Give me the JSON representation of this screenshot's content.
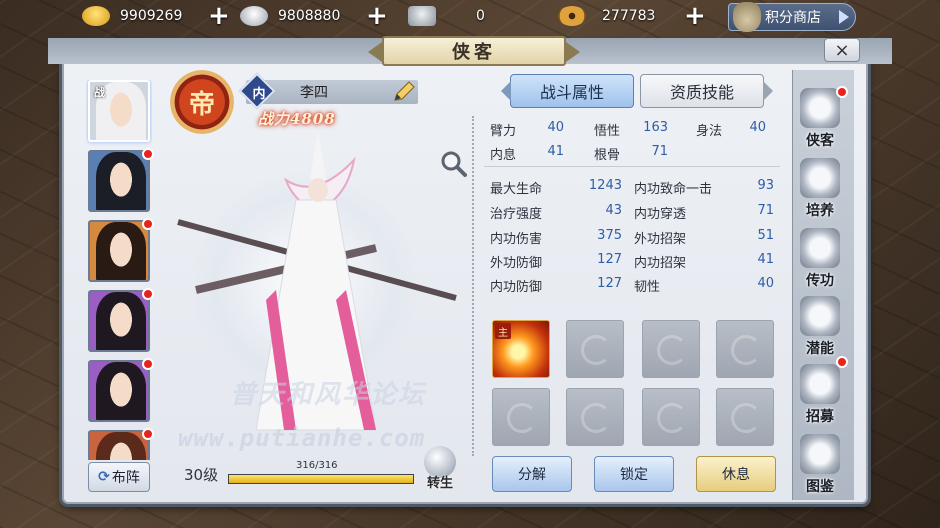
{
  "resources": [
    {
      "id": "gold",
      "value": "9909269",
      "color": "#f2c12e",
      "icon": "gold-ingot-icon"
    },
    {
      "id": "silver",
      "value": "9808880",
      "color": "#d8dde4",
      "icon": "silver-ingot-icon"
    },
    {
      "id": "ticket",
      "value": "0",
      "color": "#c9ced6",
      "icon": "ticket-icon"
    },
    {
      "id": "coin",
      "value": "277783",
      "color": "#d2862a",
      "icon": "copper-coin-icon"
    }
  ],
  "shop": {
    "label": "积分商店"
  },
  "panel": {
    "title": "侠客",
    "close": "×"
  },
  "portraits": [
    {
      "name": "portrait-1",
      "hair": "#e8e8ea",
      "selected": true,
      "dot": false,
      "tag": "战"
    },
    {
      "name": "portrait-2",
      "hair": "#1b1e27",
      "dot": true
    },
    {
      "name": "portrait-3",
      "hair": "#2a1a14",
      "dot": true
    },
    {
      "name": "portrait-4",
      "hair": "#1f1820",
      "dot": true
    },
    {
      "name": "portrait-5",
      "hair": "#1f1820",
      "dot": true
    },
    {
      "name": "portrait-6",
      "hair": "#5b2a1a",
      "dot": true
    }
  ],
  "lineup": {
    "label": "布阵"
  },
  "hero": {
    "emblem": "帝",
    "badge": "内",
    "name": "李四",
    "power": "战力4808",
    "level": "30级",
    "exp": "316/316",
    "exp_ratio": 1.0,
    "rebirth": "转生"
  },
  "watermark": {
    "line1": "普天和风华论坛",
    "line2": "www.putianhe.com"
  },
  "tabs": {
    "combat": "战斗属性",
    "talent": "资质技能"
  },
  "base_stats": [
    {
      "k": "臂力",
      "v": "40"
    },
    {
      "k": "悟性",
      "v": "163"
    },
    {
      "k": "身法",
      "v": "40"
    },
    {
      "k": "内息",
      "v": "41"
    },
    {
      "k": "根骨",
      "v": "71"
    }
  ],
  "combat_stats": [
    {
      "k": "最大生命",
      "v": "1243"
    },
    {
      "k": "内功致命一击",
      "v": "93"
    },
    {
      "k": "治疗强度",
      "v": "43"
    },
    {
      "k": "内功穿透",
      "v": "71"
    },
    {
      "k": "内功伤害",
      "v": "375"
    },
    {
      "k": "外功招架",
      "v": "51"
    },
    {
      "k": "外功防御",
      "v": "127"
    },
    {
      "k": "内功招架",
      "v": "41"
    },
    {
      "k": "内功防御",
      "v": "127"
    },
    {
      "k": "韧性",
      "v": "40"
    }
  ],
  "skill_tag": "主",
  "buttons": {
    "decompose": "分解",
    "lock": "锁定",
    "rest": "休息"
  },
  "sidebar": [
    {
      "label": "侠客",
      "icon": "hero-icon",
      "dot": true
    },
    {
      "label": "培养",
      "icon": "scroll-icon",
      "dot": false
    },
    {
      "label": "传功",
      "icon": "transfer-icon",
      "dot": false
    },
    {
      "label": "潜能",
      "icon": "potential-icon",
      "dot": false
    },
    {
      "label": "招募",
      "icon": "recruit-icon",
      "dot": true
    },
    {
      "label": "图鉴",
      "icon": "book-icon",
      "dot": false
    }
  ]
}
